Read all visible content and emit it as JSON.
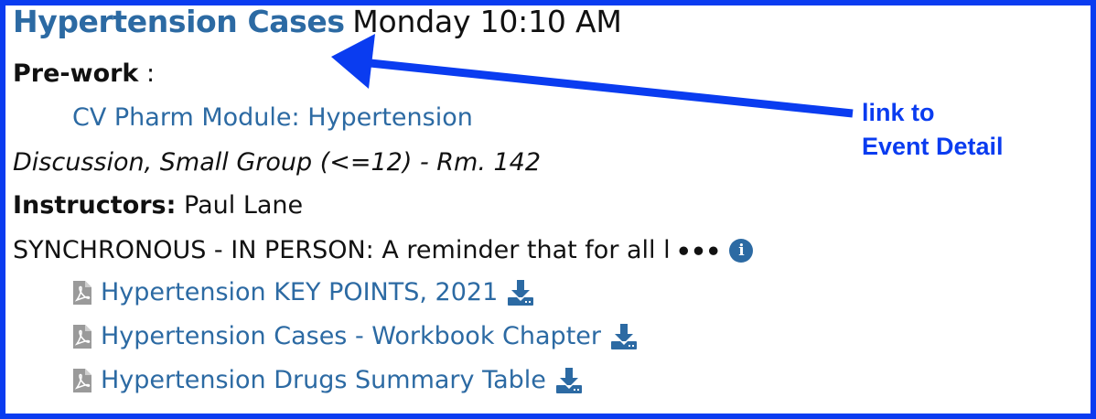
{
  "event": {
    "title": "Hypertension Cases",
    "time": "Monday 10:10 AM"
  },
  "prework": {
    "label": "Pre-work",
    "separator": " :",
    "module_link": "CV Pharm Module: Hypertension"
  },
  "session": {
    "type_location": "Discussion, Small Group (<=12) - Rm. 142"
  },
  "instructors": {
    "label": "Instructors:",
    "names": " Paul Lane"
  },
  "note": {
    "text": "SYNCHRONOUS - IN PERSON: A reminder that for all l",
    "more": "•••",
    "info_icon": "i"
  },
  "files": [
    {
      "label": "Hypertension KEY POINTS, 2021",
      "icon": "pdf-file-icon",
      "action_icon": "download-icon"
    },
    {
      "label": "Hypertension Cases - Workbook Chapter",
      "icon": "pdf-file-icon",
      "action_icon": "download-icon"
    },
    {
      "label": "Hypertension Drugs Summary Table",
      "icon": "pdf-file-icon",
      "action_icon": "download-icon"
    }
  ],
  "annotation": {
    "line1": "link to",
    "line2": "Event Detail",
    "color": "#0a3cf0"
  },
  "colors": {
    "link": "#2c6aa3",
    "border": "#0a3cf0"
  }
}
